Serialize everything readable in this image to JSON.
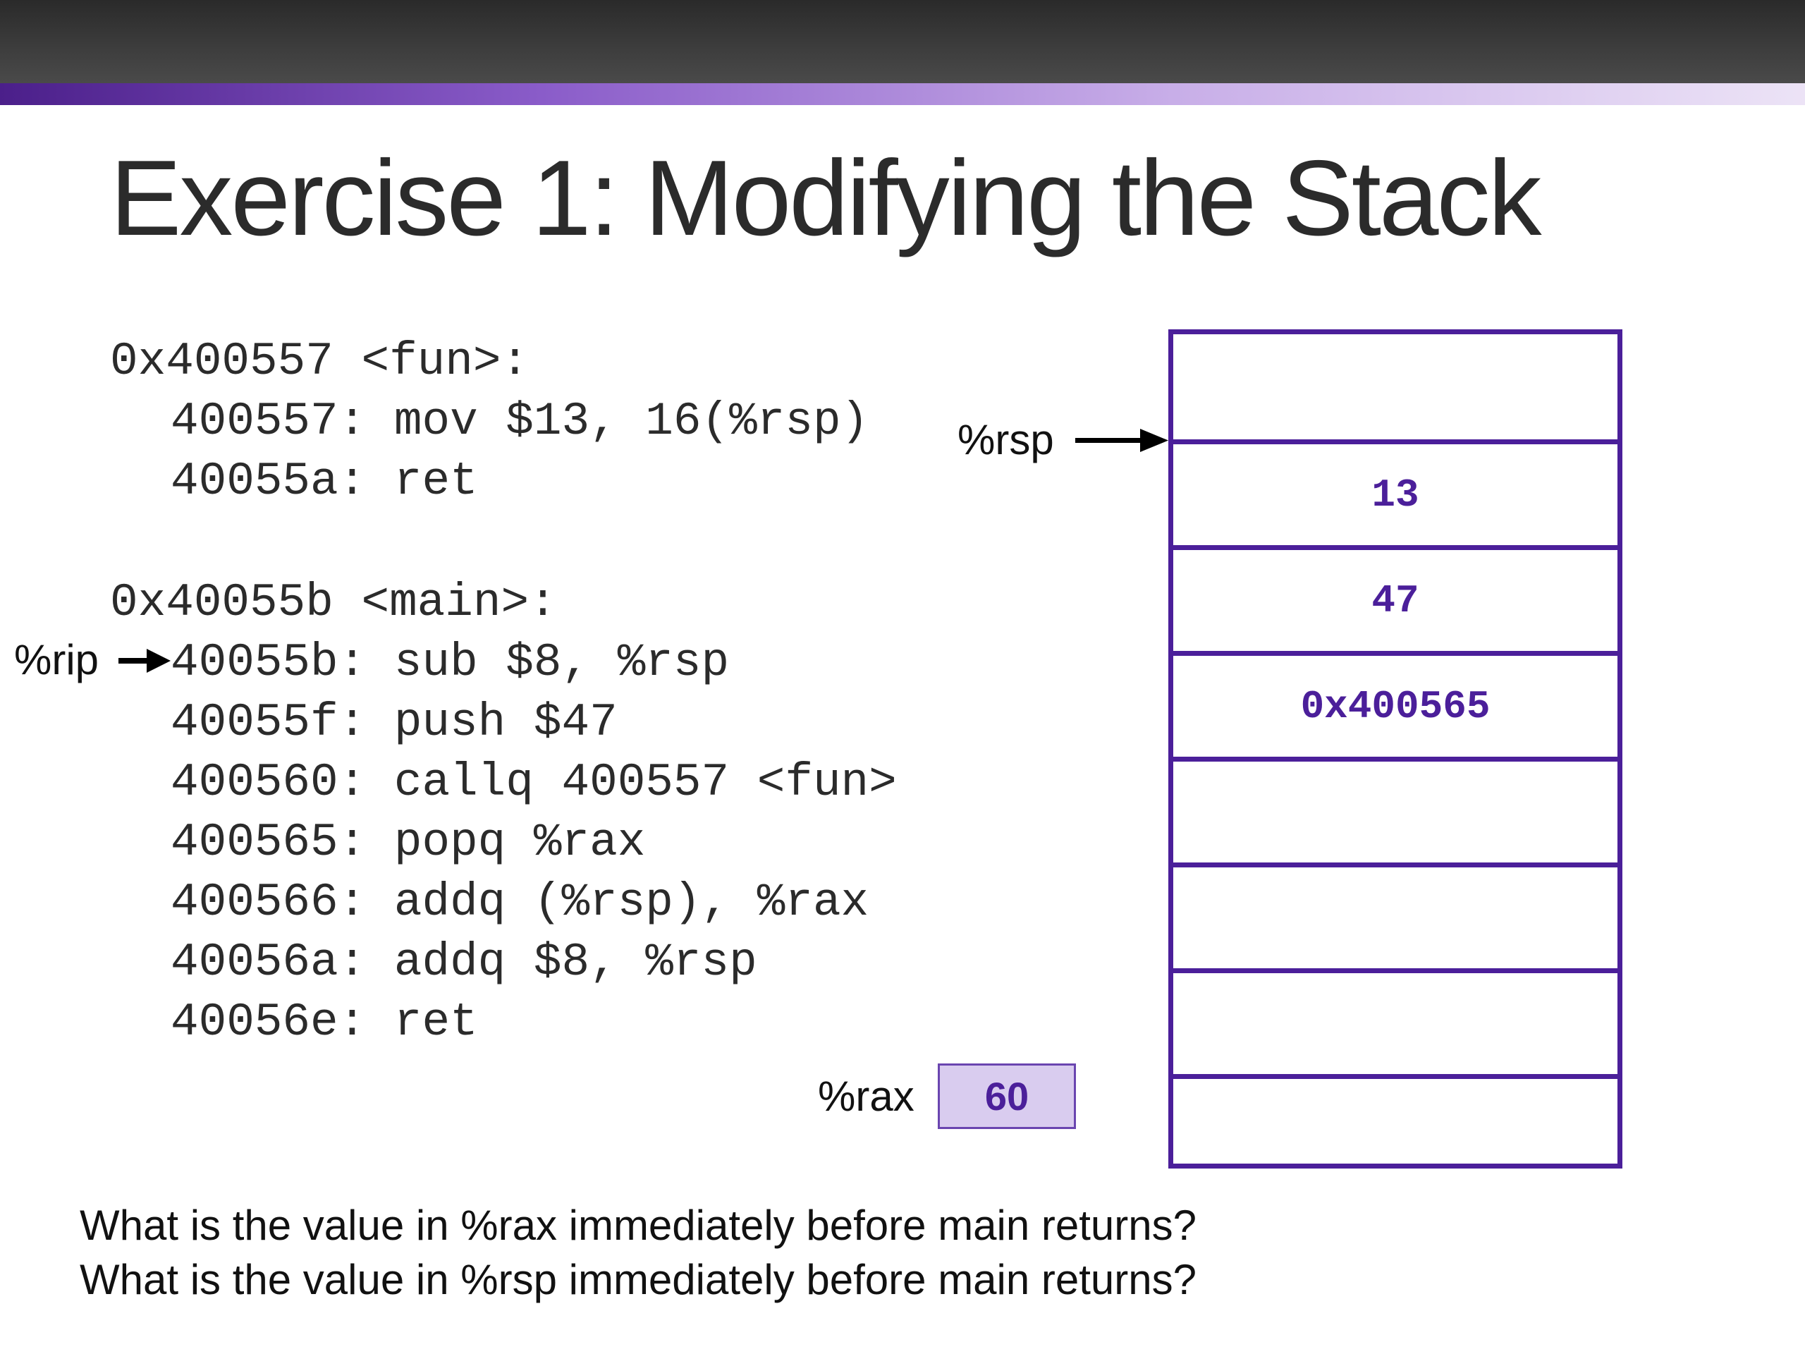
{
  "slide": {
    "title": "Exercise 1: Modifying the Stack"
  },
  "code": {
    "fun_header": "0x400557 <fun>:",
    "fun_lines": [
      "400557: mov $13, 16(%rsp)",
      "40055a: ret"
    ],
    "main_header": "0x40055b <main>:",
    "main_lines": [
      "40055b: sub $8, %rsp",
      "40055f: push $47",
      "400560: callq 400557 <fun>",
      "400565: popq %rax",
      "400566: addq (%rsp), %rax",
      "40056a: addq $8, %rsp",
      "40056e: ret"
    ]
  },
  "registers": {
    "rip_label": "%rip",
    "rsp_label": "%rsp",
    "rax_label": "%rax",
    "rax_value": "60"
  },
  "stack": {
    "cells": [
      "",
      "13",
      "47",
      "0x400565",
      "",
      "",
      "",
      ""
    ]
  },
  "questions": [
    "What is the value in %rax immediately before main returns?",
    "What is the value in %rsp immediately before main returns?"
  ],
  "colors": {
    "accent": "#4b1f9a",
    "rax_fill": "#d9ccef"
  }
}
